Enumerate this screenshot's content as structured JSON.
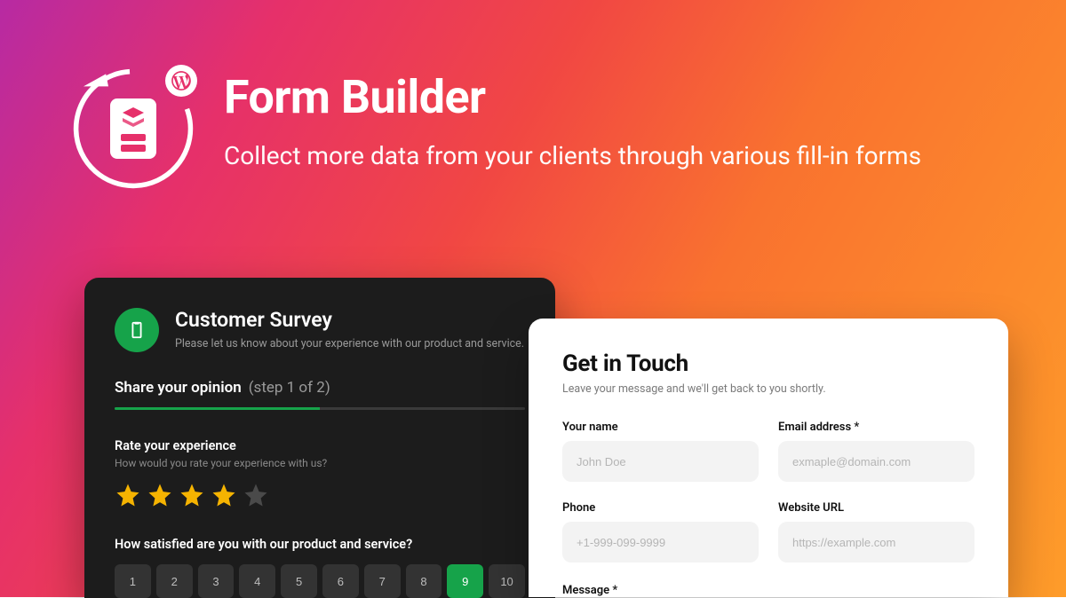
{
  "hero": {
    "title": "Form Builder",
    "subtitle": "Collect more data from your clients through various fill-in forms"
  },
  "survey": {
    "title": "Customer Survey",
    "description": "Please let us know about your experience with our product and service.",
    "step_lead": "Share your opinion",
    "step_paren": "(step 1 of 2)",
    "progress_percent": 50,
    "q1": {
      "label": "Rate your experience",
      "sub": "How would you rate your experience with us?",
      "rating": 4,
      "max": 5
    },
    "q2": {
      "label": "How satisfied are you with our product and service?",
      "options": [
        "1",
        "2",
        "3",
        "4",
        "5",
        "6",
        "7",
        "8",
        "9",
        "10"
      ],
      "selected": "9"
    }
  },
  "contact": {
    "title": "Get in Touch",
    "subtitle": "Leave your message and we'll get back to you shortly.",
    "fields": {
      "name": {
        "label": "Your name",
        "placeholder": "John Doe"
      },
      "email": {
        "label": "Email address *",
        "placeholder": "exmaple@domain.com"
      },
      "phone": {
        "label": "Phone",
        "placeholder": "+1-999-099-9999"
      },
      "website": {
        "label": "Website URL",
        "placeholder": "https://example.com"
      },
      "message": {
        "label": "Message *"
      }
    }
  },
  "colors": {
    "accent_green": "#16a34a",
    "star_on": "#f5b301"
  }
}
